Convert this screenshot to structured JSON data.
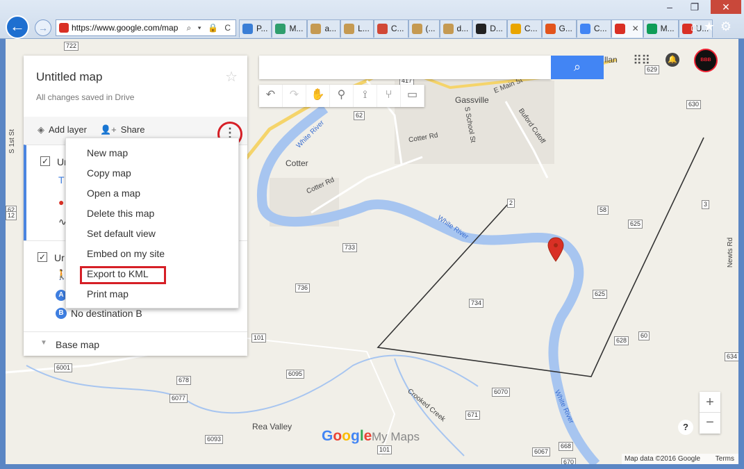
{
  "browser": {
    "url": "https://www.google.com/map",
    "tabs": [
      {
        "label": "P...",
        "color": "#3a7ed6"
      },
      {
        "label": "M...",
        "color": "#2f9e6d"
      },
      {
        "label": "a...",
        "color": "#c59a52"
      },
      {
        "label": "L...",
        "color": "#c59a52"
      },
      {
        "label": "C...",
        "color": "#d14836"
      },
      {
        "label": "(...",
        "color": "#c59a52"
      },
      {
        "label": "d...",
        "color": "#c59a52"
      },
      {
        "label": "D...",
        "color": "#222222"
      },
      {
        "label": "C...",
        "color": "#e9a500"
      },
      {
        "label": "G...",
        "color": "#e2541c"
      },
      {
        "label": "C...",
        "color": "#4285f4"
      },
      {
        "label": "",
        "color": "#d93025",
        "active": true
      },
      {
        "label": "M...",
        "color": "#0f9d58"
      },
      {
        "label": "U...",
        "color": "#d93025"
      }
    ]
  },
  "panel": {
    "title": "Untitled map",
    "save_status": "All changes saved in Drive",
    "add_layer": "Add layer",
    "share": "Share",
    "layer1_name": "Ur",
    "layer2_name": "Ur",
    "dest_b_circle": "B",
    "dest_a_circle": "A",
    "no_destination_b": "No destination B",
    "base_map": "Base map"
  },
  "menu": {
    "items": [
      "New map",
      "Copy map",
      "Open a map",
      "Delete this map",
      "Set default view",
      "Embed on my site",
      "Export to KML",
      "Print map"
    ]
  },
  "search": {
    "placeholder": ""
  },
  "map": {
    "places": {
      "gassville": "Gassville",
      "cotter": "Cotter",
      "rea_valley": "Rea Valley",
      "allan": "llan"
    },
    "roads": {
      "e_main": "E Main St",
      "s_school": "S School St",
      "buford": "Buford Cutoff",
      "cotter_rd1": "Cotter Rd",
      "cotter_rd2": "Cotter Rd",
      "newts": "Newts Rd",
      "crooked": "Crooked Creek",
      "s_1st": "S 1st St"
    },
    "rivers": {
      "r1": "White River",
      "r2": "White River",
      "r3": "White River"
    },
    "shields": [
      "722",
      "629",
      "630",
      "417",
      "62",
      "2",
      "3",
      "58",
      "625",
      "733",
      "736",
      "734",
      "625",
      "628",
      "60",
      "634",
      "101",
      "6001",
      "678",
      "6077",
      "6095",
      "6070",
      "671",
      "6093",
      "101",
      "6067",
      "668",
      "670",
      "62",
      "12"
    ]
  },
  "branding": {
    "google": "Google",
    "my_maps": "My Maps"
  },
  "attribution": {
    "data": "Map data ©2016 Google",
    "terms": "Terms"
  },
  "avatar_text": "BBB"
}
